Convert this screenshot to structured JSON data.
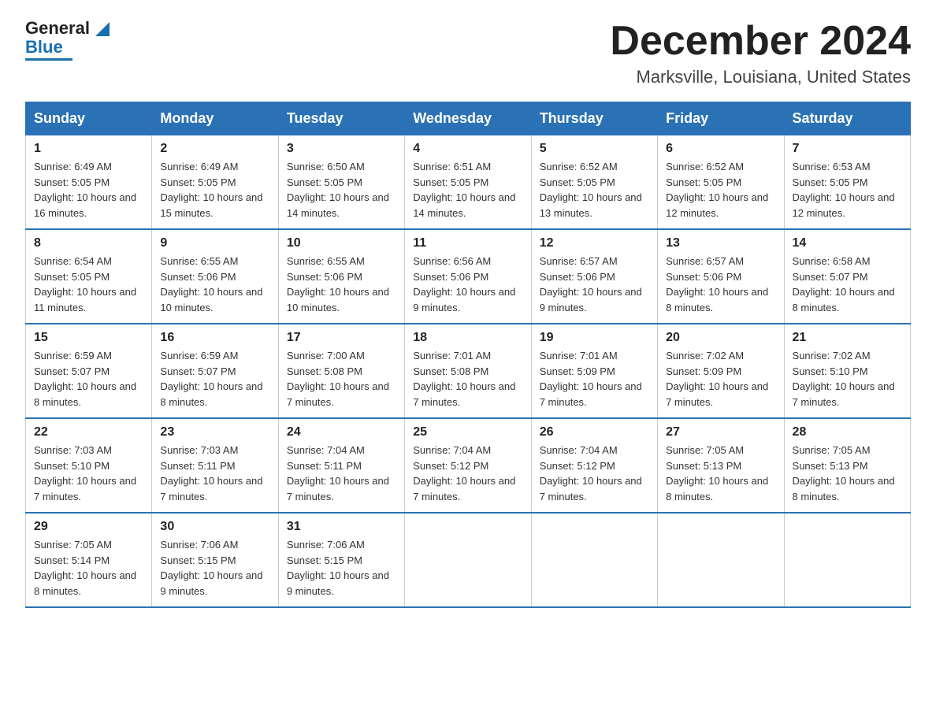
{
  "logo": {
    "name_part1": "General",
    "name_part2": "Blue"
  },
  "header": {
    "month": "December 2024",
    "location": "Marksville, Louisiana, United States"
  },
  "days_of_week": [
    "Sunday",
    "Monday",
    "Tuesday",
    "Wednesday",
    "Thursday",
    "Friday",
    "Saturday"
  ],
  "weeks": [
    [
      {
        "day": "1",
        "sunrise": "6:49 AM",
        "sunset": "5:05 PM",
        "daylight": "10 hours and 16 minutes."
      },
      {
        "day": "2",
        "sunrise": "6:49 AM",
        "sunset": "5:05 PM",
        "daylight": "10 hours and 15 minutes."
      },
      {
        "day": "3",
        "sunrise": "6:50 AM",
        "sunset": "5:05 PM",
        "daylight": "10 hours and 14 minutes."
      },
      {
        "day": "4",
        "sunrise": "6:51 AM",
        "sunset": "5:05 PM",
        "daylight": "10 hours and 14 minutes."
      },
      {
        "day": "5",
        "sunrise": "6:52 AM",
        "sunset": "5:05 PM",
        "daylight": "10 hours and 13 minutes."
      },
      {
        "day": "6",
        "sunrise": "6:52 AM",
        "sunset": "5:05 PM",
        "daylight": "10 hours and 12 minutes."
      },
      {
        "day": "7",
        "sunrise": "6:53 AM",
        "sunset": "5:05 PM",
        "daylight": "10 hours and 12 minutes."
      }
    ],
    [
      {
        "day": "8",
        "sunrise": "6:54 AM",
        "sunset": "5:05 PM",
        "daylight": "10 hours and 11 minutes."
      },
      {
        "day": "9",
        "sunrise": "6:55 AM",
        "sunset": "5:06 PM",
        "daylight": "10 hours and 10 minutes."
      },
      {
        "day": "10",
        "sunrise": "6:55 AM",
        "sunset": "5:06 PM",
        "daylight": "10 hours and 10 minutes."
      },
      {
        "day": "11",
        "sunrise": "6:56 AM",
        "sunset": "5:06 PM",
        "daylight": "10 hours and 9 minutes."
      },
      {
        "day": "12",
        "sunrise": "6:57 AM",
        "sunset": "5:06 PM",
        "daylight": "10 hours and 9 minutes."
      },
      {
        "day": "13",
        "sunrise": "6:57 AM",
        "sunset": "5:06 PM",
        "daylight": "10 hours and 8 minutes."
      },
      {
        "day": "14",
        "sunrise": "6:58 AM",
        "sunset": "5:07 PM",
        "daylight": "10 hours and 8 minutes."
      }
    ],
    [
      {
        "day": "15",
        "sunrise": "6:59 AM",
        "sunset": "5:07 PM",
        "daylight": "10 hours and 8 minutes."
      },
      {
        "day": "16",
        "sunrise": "6:59 AM",
        "sunset": "5:07 PM",
        "daylight": "10 hours and 8 minutes."
      },
      {
        "day": "17",
        "sunrise": "7:00 AM",
        "sunset": "5:08 PM",
        "daylight": "10 hours and 7 minutes."
      },
      {
        "day": "18",
        "sunrise": "7:01 AM",
        "sunset": "5:08 PM",
        "daylight": "10 hours and 7 minutes."
      },
      {
        "day": "19",
        "sunrise": "7:01 AM",
        "sunset": "5:09 PM",
        "daylight": "10 hours and 7 minutes."
      },
      {
        "day": "20",
        "sunrise": "7:02 AM",
        "sunset": "5:09 PM",
        "daylight": "10 hours and 7 minutes."
      },
      {
        "day": "21",
        "sunrise": "7:02 AM",
        "sunset": "5:10 PM",
        "daylight": "10 hours and 7 minutes."
      }
    ],
    [
      {
        "day": "22",
        "sunrise": "7:03 AM",
        "sunset": "5:10 PM",
        "daylight": "10 hours and 7 minutes."
      },
      {
        "day": "23",
        "sunrise": "7:03 AM",
        "sunset": "5:11 PM",
        "daylight": "10 hours and 7 minutes."
      },
      {
        "day": "24",
        "sunrise": "7:04 AM",
        "sunset": "5:11 PM",
        "daylight": "10 hours and 7 minutes."
      },
      {
        "day": "25",
        "sunrise": "7:04 AM",
        "sunset": "5:12 PM",
        "daylight": "10 hours and 7 minutes."
      },
      {
        "day": "26",
        "sunrise": "7:04 AM",
        "sunset": "5:12 PM",
        "daylight": "10 hours and 7 minutes."
      },
      {
        "day": "27",
        "sunrise": "7:05 AM",
        "sunset": "5:13 PM",
        "daylight": "10 hours and 8 minutes."
      },
      {
        "day": "28",
        "sunrise": "7:05 AM",
        "sunset": "5:13 PM",
        "daylight": "10 hours and 8 minutes."
      }
    ],
    [
      {
        "day": "29",
        "sunrise": "7:05 AM",
        "sunset": "5:14 PM",
        "daylight": "10 hours and 8 minutes."
      },
      {
        "day": "30",
        "sunrise": "7:06 AM",
        "sunset": "5:15 PM",
        "daylight": "10 hours and 9 minutes."
      },
      {
        "day": "31",
        "sunrise": "7:06 AM",
        "sunset": "5:15 PM",
        "daylight": "10 hours and 9 minutes."
      },
      null,
      null,
      null,
      null
    ]
  ],
  "labels": {
    "sunrise": "Sunrise:",
    "sunset": "Sunset:",
    "daylight": "Daylight:"
  }
}
